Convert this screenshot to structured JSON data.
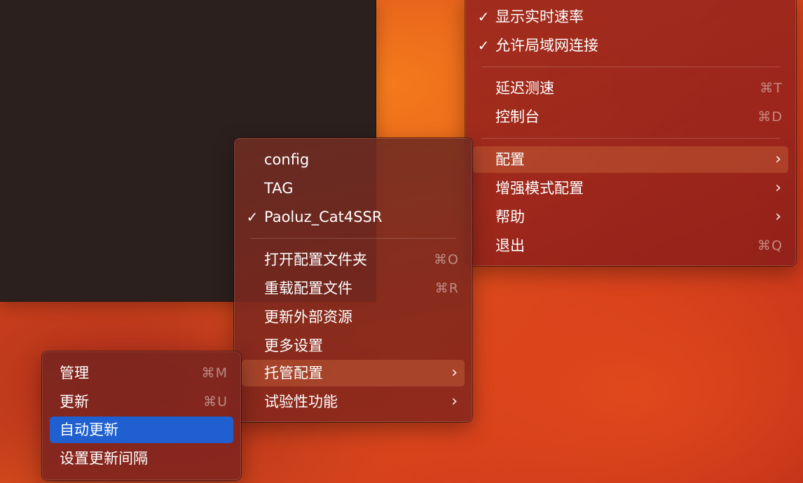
{
  "main_menu": {
    "items": [
      {
        "check": "✓",
        "label": "显示实时速率",
        "shortcut": "",
        "chevron": ""
      },
      {
        "check": "✓",
        "label": "允许局域网连接",
        "shortcut": "",
        "chevron": ""
      },
      {
        "check": "",
        "label": "延迟测速",
        "shortcut": "⌘T",
        "chevron": ""
      },
      {
        "check": "",
        "label": "控制台",
        "shortcut": "⌘D",
        "chevron": ""
      },
      {
        "check": "",
        "label": "配置",
        "shortcut": "",
        "chevron": "›"
      },
      {
        "check": "",
        "label": "增强模式配置",
        "shortcut": "",
        "chevron": "›"
      },
      {
        "check": "",
        "label": "帮助",
        "shortcut": "",
        "chevron": "›"
      },
      {
        "check": "",
        "label": "退出",
        "shortcut": "⌘Q",
        "chevron": ""
      }
    ]
  },
  "config_menu": {
    "items": [
      {
        "check": "",
        "label": "config",
        "shortcut": "",
        "chevron": ""
      },
      {
        "check": "",
        "label": "TAG",
        "shortcut": "",
        "chevron": ""
      },
      {
        "check": "✓",
        "label": "Paoluz_Cat4SSR",
        "shortcut": "",
        "chevron": ""
      },
      {
        "check": "",
        "label": "打开配置文件夹",
        "shortcut": "⌘O",
        "chevron": ""
      },
      {
        "check": "",
        "label": "重载配置文件",
        "shortcut": "⌘R",
        "chevron": ""
      },
      {
        "check": "",
        "label": "更新外部资源",
        "shortcut": "",
        "chevron": ""
      },
      {
        "check": "",
        "label": "更多设置",
        "shortcut": "",
        "chevron": ""
      },
      {
        "check": "",
        "label": "托管配置",
        "shortcut": "",
        "chevron": "›"
      },
      {
        "check": "",
        "label": "试验性功能",
        "shortcut": "",
        "chevron": "›"
      }
    ]
  },
  "hosted_menu": {
    "items": [
      {
        "label": "管理",
        "shortcut": "⌘M"
      },
      {
        "label": "更新",
        "shortcut": "⌘U"
      },
      {
        "label": "自动更新",
        "shortcut": ""
      },
      {
        "label": "设置更新间隔",
        "shortcut": ""
      }
    ]
  },
  "colors": {
    "selection": "#1f5fcf",
    "submenu_highlight": "#c8643c"
  },
  "icons": {
    "checkmark": "checkmark-icon",
    "chevron": "chevron-right-icon"
  }
}
